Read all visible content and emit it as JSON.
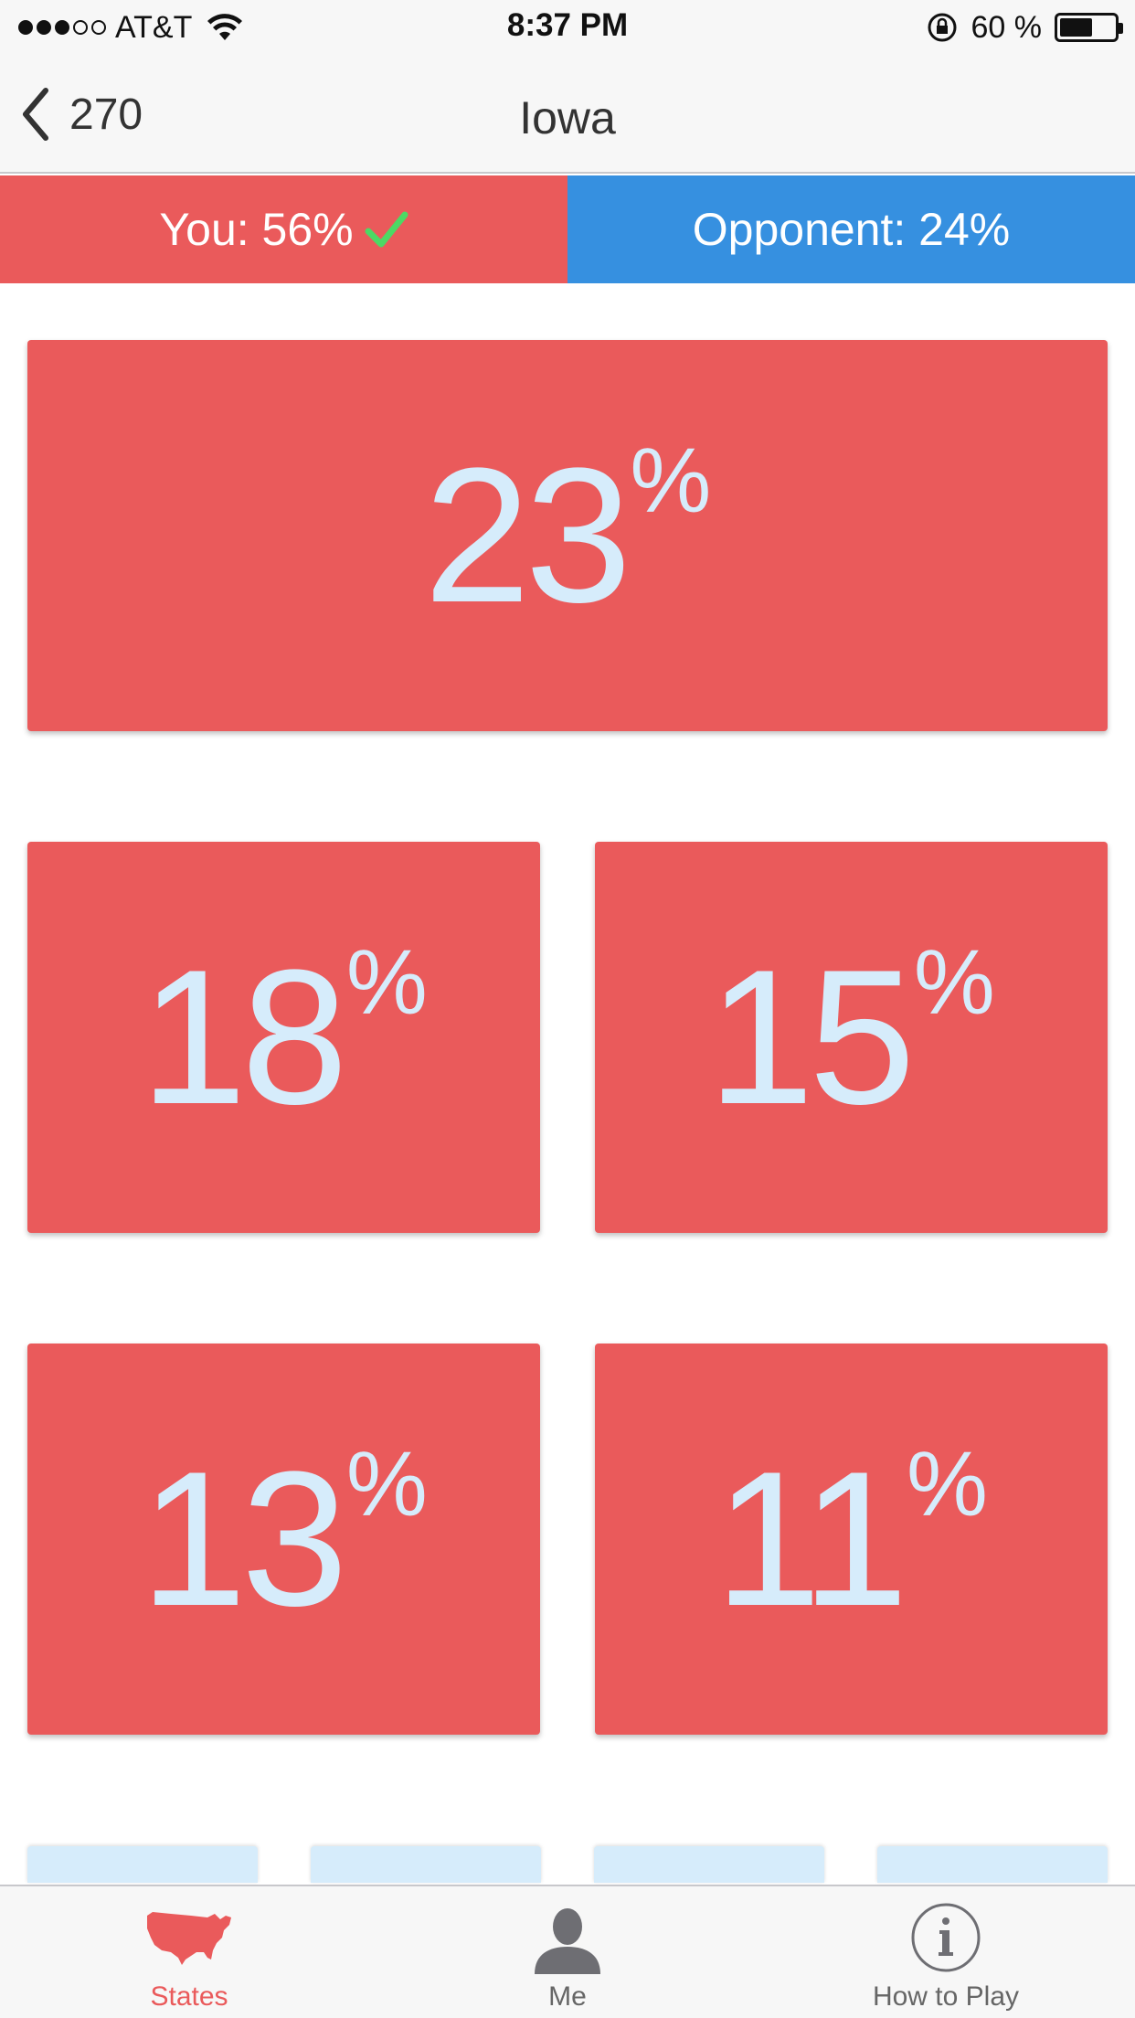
{
  "status_bar": {
    "carrier": "AT&T",
    "signal_bars_filled": 3,
    "signal_bars_total": 5,
    "time": "8:37 PM",
    "battery_percent_label": "60 %",
    "battery_level": 0.6
  },
  "nav": {
    "back_label": "270",
    "title": "Iowa"
  },
  "score": {
    "you_label": "You: 56%",
    "opponent_label": "Opponent: 24%"
  },
  "options": [
    {
      "value": "23",
      "symbol": "%"
    },
    {
      "value": "18",
      "symbol": "%"
    },
    {
      "value": "15",
      "symbol": "%"
    },
    {
      "value": "13",
      "symbol": "%"
    },
    {
      "value": "11",
      "symbol": "%"
    }
  ],
  "tabs": [
    {
      "label": "States",
      "icon": "usa-map-icon",
      "active": true
    },
    {
      "label": "Me",
      "icon": "person-icon",
      "active": false
    },
    {
      "label": "How to Play",
      "icon": "info-icon",
      "active": false
    }
  ],
  "colors": {
    "red": "#ea5a5b",
    "blue": "#3690e0",
    "light_blue": "#d6ecfb",
    "check_green": "#4cd964"
  }
}
